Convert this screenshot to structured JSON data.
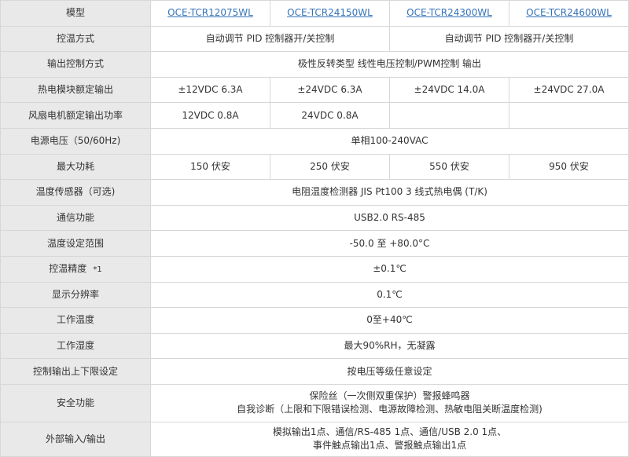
{
  "rows": {
    "model": {
      "label": "模型",
      "values": [
        "OCE-TCR12075WL",
        "OCE-TCR24150WL",
        "OCE-TCR24300WL",
        "OCE-TCR24600WL"
      ]
    },
    "control_method": {
      "label": "控温方式",
      "values": [
        "自动调节 PID 控制器开/关控制",
        "自动调节 PID 控制器开/关控制"
      ]
    },
    "output_control": {
      "label": "输出控制方式",
      "value": "极性反转类型 线性电压控制/PWM控制 输出"
    },
    "thermo_output": {
      "label": "热电模块额定输出",
      "values": [
        "±12VDC 6.3A",
        "±24VDC 6.3A",
        "±24VDC 14.0A",
        "±24VDC 27.0A"
      ]
    },
    "fan_output": {
      "label": "风扇电机额定输出功率",
      "values": [
        "12VDC 0.8A",
        "24VDC 0.8A",
        "",
        ""
      ]
    },
    "power_voltage": {
      "label": "电源电压（50/60Hz)",
      "value": "单相100-240VAC"
    },
    "max_power": {
      "label": "最大功耗",
      "values": [
        "150 伏安",
        "250 伏安",
        "550 伏安",
        "950 伏安"
      ]
    },
    "sensor": {
      "label": "温度传感器（可选)",
      "value": "电阻温度检测器 JIS Pt100 3 线式热电偶 (T/K)"
    },
    "communication": {
      "label": "通信功能",
      "value": "USB2.0 RS-485"
    },
    "temp_range": {
      "label": "温度设定范围",
      "value": "-50.0 至 +80.0°C"
    },
    "accuracy": {
      "label": "控温精度",
      "note": "*1",
      "value": "±0.1℃"
    },
    "resolution": {
      "label": "显示分辨率",
      "value": "0.1℃"
    },
    "operating_temp": {
      "label": "工作温度",
      "value": "0至+40℃"
    },
    "operating_humidity": {
      "label": "工作湿度",
      "value": "最大90%RH，无凝露"
    },
    "output_limits": {
      "label": "控制输出上下限设定",
      "value": "按电压等级任意设定"
    },
    "safety": {
      "label": "安全功能",
      "lines": [
        "保险丝（一次侧双重保护）警报蜂鸣器",
        "自我诊断（上限和下限错误检测、电源故障检测、热敏电阻关断温度检测)"
      ]
    },
    "external_io": {
      "label": "外部输入/输出",
      "lines": [
        "模拟输出1点、通信/RS-485 1点、通信/USB 2.0 1点、",
        "事件触点输出1点、警报触点输出1点"
      ]
    }
  },
  "colors": {
    "label_bg": "#e9e9e9",
    "border": "#d7d7d7",
    "link": "#3574b8",
    "text": "#333333"
  }
}
